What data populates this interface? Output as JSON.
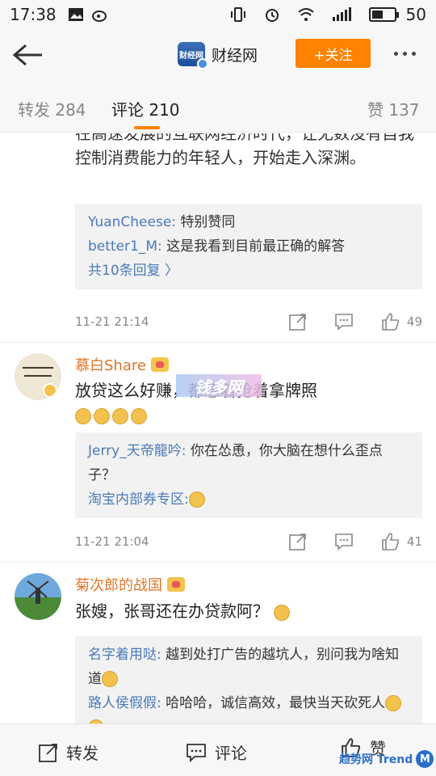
{
  "status_bar": {
    "time": "17:38",
    "battery": "50"
  },
  "header": {
    "account_name": "财经网",
    "logo_text": "财经网",
    "follow_label": "+关注"
  },
  "tabs": [
    {
      "label": "转发 284"
    },
    {
      "label": "评论 210"
    },
    {
      "label": "赞 137"
    }
  ],
  "colors": {
    "accent": "#ff8200",
    "link": "#4a7ab8",
    "username": "#e0762a"
  },
  "comments": [
    {
      "text": "在高速发展的互联网经济时代，让无数没有自我控制消费能力的年轻人，开始走入深渊。",
      "replies": [
        {
          "user": "YuanCheese:",
          "text": " 特别赞同"
        },
        {
          "user": "better1_M:",
          "text": " 这是我看到目前最正确的解答"
        }
      ],
      "more_replies": "共10条回复 〉",
      "time": "11-21 21:14",
      "likes": "49"
    },
    {
      "user": "慕白Share",
      "text": "放贷这么好赚，都急着抢着拿牌照",
      "replies": [
        {
          "user": "Jerry_天帝龍吟:",
          "text": " 你在怂恿，你大脑在想什么歪点子？"
        },
        {
          "user": "淘宝内部券专区:",
          "text": ""
        }
      ],
      "time": "11-21 21:04",
      "likes": "41"
    },
    {
      "user": "菊次郎的战国",
      "text": "张嫂，张哥还在办贷款阿？",
      "replies": [
        {
          "user": "名字着用哒:",
          "text": " 越到处打广告的越坑人，别问我为啥知道"
        },
        {
          "user": "路人侯假假:",
          "text": " 哈哈哈，诚信高效，最快当天砍死人"
        }
      ]
    }
  ],
  "watermark_text": "钱多网",
  "bottom_bar": {
    "repost": "转发",
    "comment": "评论",
    "like": "赞"
  },
  "trend_label": "趋势网 Trend"
}
